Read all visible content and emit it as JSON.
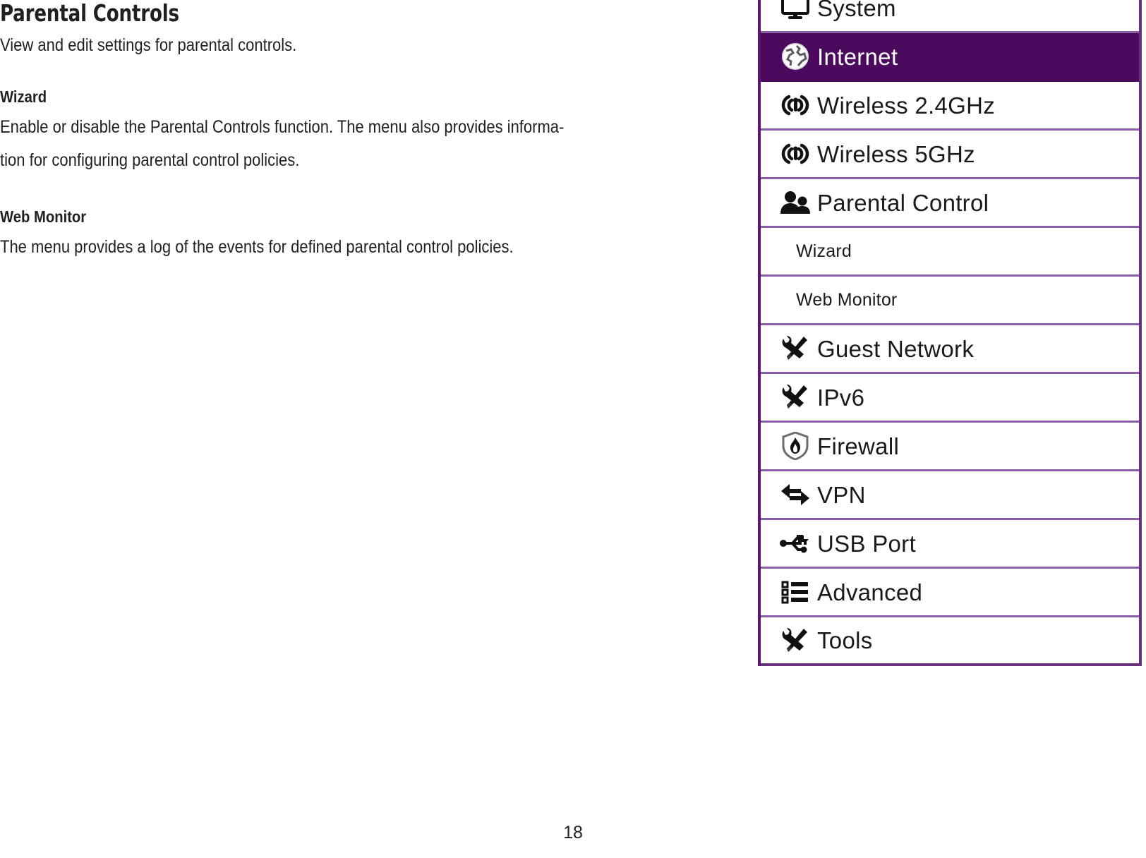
{
  "document": {
    "title": "Parental Controls",
    "lede": "View and edit settings for parental controls.",
    "sections": [
      {
        "heading": "Wizard",
        "lines": [
          "Enable or disable the Parental Controls function. The menu also provides informa-",
          "tion for configuring parental control policies."
        ]
      },
      {
        "heading": "Web Monitor",
        "lines": [
          "The menu provides a log of the events for defined parental control policies."
        ]
      }
    ],
    "page_number": "18"
  },
  "nav_menu": {
    "highlight_color": "#4b0a5e",
    "separator_color": "#8b5fa8",
    "border_color": "#5b1470",
    "items": [
      {
        "label": "System",
        "icon": "monitor-icon",
        "active": false,
        "sub": false
      },
      {
        "label": "Internet",
        "icon": "globe-icon",
        "active": true,
        "sub": false
      },
      {
        "label": "Wireless 2.4GHz",
        "icon": "wireless-signal-icon",
        "active": false,
        "sub": false
      },
      {
        "label": "Wireless 5GHz",
        "icon": "wireless-signal-icon",
        "active": false,
        "sub": false
      },
      {
        "label": "Parental Control",
        "icon": "people-icon",
        "active": false,
        "sub": false
      },
      {
        "label": "Wizard",
        "icon": "",
        "active": false,
        "sub": true
      },
      {
        "label": "Web Monitor",
        "icon": "",
        "active": false,
        "sub": true
      },
      {
        "label": "Guest Network",
        "icon": "tools-icon",
        "active": false,
        "sub": false
      },
      {
        "label": "IPv6",
        "icon": "tools-icon",
        "active": false,
        "sub": false
      },
      {
        "label": "Firewall",
        "icon": "shield-flame-icon",
        "active": false,
        "sub": false
      },
      {
        "label": "VPN",
        "icon": "arrows-exchange-icon",
        "active": false,
        "sub": false
      },
      {
        "label": "USB Port",
        "icon": "usb-icon",
        "active": false,
        "sub": false
      },
      {
        "label": "Advanced",
        "icon": "list-icon",
        "active": false,
        "sub": false
      },
      {
        "label": "Tools",
        "icon": "tools-icon",
        "active": false,
        "sub": false
      }
    ]
  }
}
